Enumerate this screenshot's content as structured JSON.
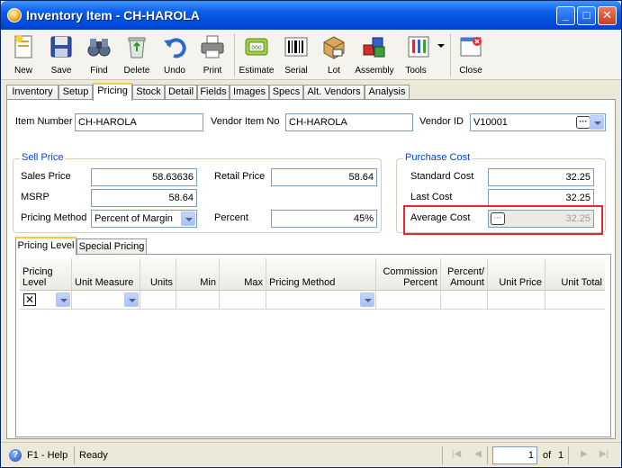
{
  "window": {
    "title": "Inventory Item - CH-HAROLA"
  },
  "toolbar": {
    "new": "New",
    "save": "Save",
    "find": "Find",
    "delete": "Delete",
    "undo": "Undo",
    "print": "Print",
    "estimate": "Estimate",
    "serial": "Serial",
    "lot": "Lot",
    "assembly": "Assembly",
    "tools": "Tools",
    "close": "Close"
  },
  "tabs": [
    "Inventory",
    "Setup",
    "Pricing",
    "Stock",
    "Detail",
    "Fields",
    "Images",
    "Specs",
    "Alt. Vendors",
    "Analysis"
  ],
  "header": {
    "item_number_label": "Item Number",
    "item_number": "CH-HAROLA",
    "vendor_item_no_label": "Vendor Item No",
    "vendor_item_no": "CH-HAROLA",
    "vendor_id_label": "Vendor ID",
    "vendor_id": "V10001"
  },
  "sell_price": {
    "title": "Sell Price",
    "sales_price_label": "Sales Price",
    "sales_price": "58.63636",
    "retail_price_label": "Retail Price",
    "retail_price": "58.64",
    "msrp_label": "MSRP",
    "msrp": "58.64",
    "pricing_method_label": "Pricing Method",
    "pricing_method": "Percent of Margin",
    "percent_label": "Percent",
    "percent": "45%"
  },
  "purchase_cost": {
    "title": "Purchase Cost",
    "standard_cost_label": "Standard Cost",
    "standard_cost": "32.25",
    "last_cost_label": "Last Cost",
    "last_cost": "32.25",
    "average_cost_label": "Average Cost",
    "average_cost": "32.25"
  },
  "subtabs": [
    "Pricing Level",
    "Special Pricing"
  ],
  "grid": {
    "columns": [
      "Pricing Level",
      "Unit Measure",
      "Units",
      "Min",
      "Max",
      "Pricing Method",
      "Commission Percent",
      "Percent/ Amount",
      "Unit Price",
      "Unit Total"
    ]
  },
  "status": {
    "help": "F1 - Help",
    "text": "Ready",
    "page": "1",
    "of_label": "of",
    "total_pages": "1"
  }
}
